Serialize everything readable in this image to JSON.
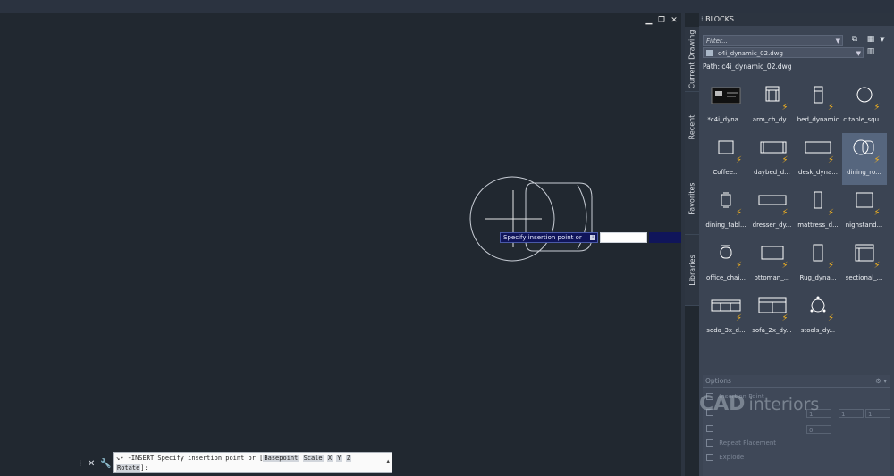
{
  "window_controls": {
    "minimize": "▁",
    "restore": "❐",
    "close": "✕"
  },
  "panel": {
    "title": "BLOCKS",
    "grip": "⁞",
    "side_tabs": [
      "Current Drawing",
      "Recent",
      "Favorites",
      "Libraries"
    ],
    "filter_placeholder": "Filter...",
    "file": "c4i_dynamic_02.dwg",
    "path": "Path: c4i_dynamic_02.dwg",
    "blocks": [
      {
        "label": "*c4i_dyna...",
        "icon": "drawing-preview-icon",
        "dynamic": false,
        "selected": false
      },
      {
        "label": "arm_ch_dy...",
        "icon": "armchair-icon",
        "dynamic": true,
        "selected": false
      },
      {
        "label": "bed_dynamic",
        "icon": "bed-icon",
        "dynamic": true,
        "selected": false
      },
      {
        "label": "c.table_squ...",
        "icon": "circle-table-icon",
        "dynamic": true,
        "selected": false
      },
      {
        "label": "Coffee...",
        "icon": "coffee-table-icon",
        "dynamic": true,
        "selected": false
      },
      {
        "label": "daybed_d...",
        "icon": "daybed-icon",
        "dynamic": true,
        "selected": false
      },
      {
        "label": "desk_dyna...",
        "icon": "desk-icon",
        "dynamic": true,
        "selected": false
      },
      {
        "label": "dining_ro...",
        "icon": "dining-room-icon",
        "dynamic": true,
        "selected": true
      },
      {
        "label": "dining_tabl...",
        "icon": "dining-table-icon",
        "dynamic": true,
        "selected": false
      },
      {
        "label": "dresser_dy...",
        "icon": "dresser-icon",
        "dynamic": true,
        "selected": false
      },
      {
        "label": "mattress_d...",
        "icon": "mattress-icon",
        "dynamic": true,
        "selected": false
      },
      {
        "label": "nighstand...",
        "icon": "nightstand-icon",
        "dynamic": true,
        "selected": false
      },
      {
        "label": "office_chai...",
        "icon": "office-chair-icon",
        "dynamic": true,
        "selected": false
      },
      {
        "label": "ottoman_...",
        "icon": "ottoman-icon",
        "dynamic": true,
        "selected": false
      },
      {
        "label": "Rug_dyna...",
        "icon": "rug-icon",
        "dynamic": true,
        "selected": false
      },
      {
        "label": "sectional_...",
        "icon": "sectional-icon",
        "dynamic": true,
        "selected": false
      },
      {
        "label": "soda_3x_d...",
        "icon": "sofa-3x-icon",
        "dynamic": true,
        "selected": false
      },
      {
        "label": "sofa_2x_dy...",
        "icon": "sofa-2x-icon",
        "dynamic": true,
        "selected": false
      },
      {
        "label": "stools_dy...",
        "icon": "stools-icon",
        "dynamic": true,
        "selected": false
      }
    ],
    "options": {
      "title": "Options",
      "insertion_point": "Insertion Point",
      "scale_values": [
        "1",
        "1",
        "1"
      ],
      "rotation": "0",
      "repeat_placement": "Repeat Placement",
      "explode": "Explode"
    }
  },
  "watermark": {
    "brand": "CAD",
    "sub": "interiors"
  },
  "command_line": {
    "command": "-INSERT",
    "prompt": "Specify insertion point or [",
    "options": [
      "Basepoint",
      "Scale",
      "X",
      "Y",
      "Z"
    ],
    "line2_option": "Rotate",
    "line2_end": "]:"
  },
  "tooltip": {
    "text": "Specify insertion point or"
  },
  "colors": {
    "canvas": "#212830",
    "panel": "#3b4453",
    "accent_bolt": "#f3b21f",
    "tooltip_bg": "#10155a"
  }
}
